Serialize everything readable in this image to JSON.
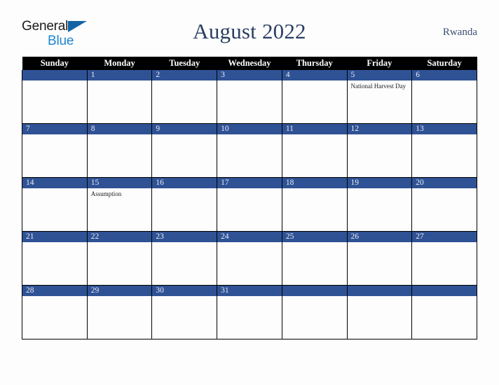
{
  "brand": {
    "line1": "General",
    "line2": "Blue",
    "triangle_color": "#1464a5",
    "line2_color": "#1f86d0"
  },
  "header": {
    "title": "August 2022",
    "country": "Rwanda",
    "title_color": "#2b3f63"
  },
  "calendar": {
    "weekday_headers": [
      "Sunday",
      "Monday",
      "Tuesday",
      "Wednesday",
      "Thursday",
      "Friday",
      "Saturday"
    ],
    "header_bg": "#000000",
    "date_bar_bg": "#2f5295",
    "weeks": [
      [
        {
          "date": "",
          "event": ""
        },
        {
          "date": "1",
          "event": ""
        },
        {
          "date": "2",
          "event": ""
        },
        {
          "date": "3",
          "event": ""
        },
        {
          "date": "4",
          "event": ""
        },
        {
          "date": "5",
          "event": "National Harvest Day"
        },
        {
          "date": "6",
          "event": ""
        }
      ],
      [
        {
          "date": "7",
          "event": ""
        },
        {
          "date": "8",
          "event": ""
        },
        {
          "date": "9",
          "event": ""
        },
        {
          "date": "10",
          "event": ""
        },
        {
          "date": "11",
          "event": ""
        },
        {
          "date": "12",
          "event": ""
        },
        {
          "date": "13",
          "event": ""
        }
      ],
      [
        {
          "date": "14",
          "event": ""
        },
        {
          "date": "15",
          "event": "Assumption"
        },
        {
          "date": "16",
          "event": ""
        },
        {
          "date": "17",
          "event": ""
        },
        {
          "date": "18",
          "event": ""
        },
        {
          "date": "19",
          "event": ""
        },
        {
          "date": "20",
          "event": ""
        }
      ],
      [
        {
          "date": "21",
          "event": ""
        },
        {
          "date": "22",
          "event": ""
        },
        {
          "date": "23",
          "event": ""
        },
        {
          "date": "24",
          "event": ""
        },
        {
          "date": "25",
          "event": ""
        },
        {
          "date": "26",
          "event": ""
        },
        {
          "date": "27",
          "event": ""
        }
      ],
      [
        {
          "date": "28",
          "event": ""
        },
        {
          "date": "29",
          "event": ""
        },
        {
          "date": "30",
          "event": ""
        },
        {
          "date": "31",
          "event": ""
        },
        {
          "date": "",
          "event": ""
        },
        {
          "date": "",
          "event": ""
        },
        {
          "date": "",
          "event": ""
        }
      ]
    ]
  }
}
